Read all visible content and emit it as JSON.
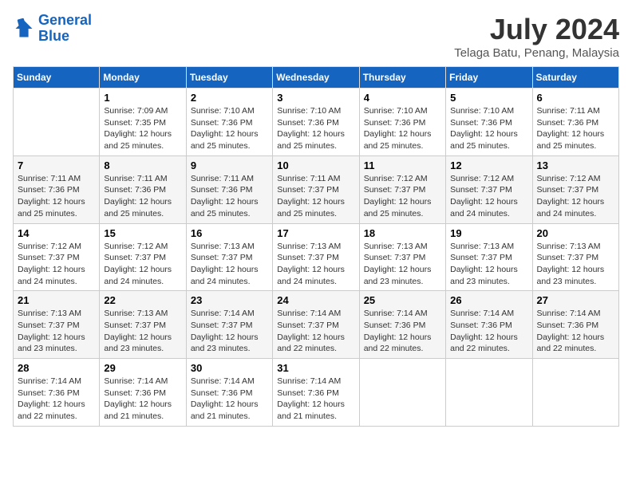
{
  "logo": {
    "line1": "General",
    "line2": "Blue"
  },
  "title": "July 2024",
  "location": "Telaga Batu, Penang, Malaysia",
  "headers": [
    "Sunday",
    "Monday",
    "Tuesday",
    "Wednesday",
    "Thursday",
    "Friday",
    "Saturday"
  ],
  "weeks": [
    [
      null,
      {
        "day": "1",
        "sunrise": "7:09 AM",
        "sunset": "7:35 PM",
        "daylight": "12 hours and 25 minutes."
      },
      {
        "day": "2",
        "sunrise": "7:10 AM",
        "sunset": "7:36 PM",
        "daylight": "12 hours and 25 minutes."
      },
      {
        "day": "3",
        "sunrise": "7:10 AM",
        "sunset": "7:36 PM",
        "daylight": "12 hours and 25 minutes."
      },
      {
        "day": "4",
        "sunrise": "7:10 AM",
        "sunset": "7:36 PM",
        "daylight": "12 hours and 25 minutes."
      },
      {
        "day": "5",
        "sunrise": "7:10 AM",
        "sunset": "7:36 PM",
        "daylight": "12 hours and 25 minutes."
      },
      {
        "day": "6",
        "sunrise": "7:11 AM",
        "sunset": "7:36 PM",
        "daylight": "12 hours and 25 minutes."
      }
    ],
    [
      {
        "day": "7",
        "sunrise": "7:11 AM",
        "sunset": "7:36 PM",
        "daylight": "12 hours and 25 minutes."
      },
      {
        "day": "8",
        "sunrise": "7:11 AM",
        "sunset": "7:36 PM",
        "daylight": "12 hours and 25 minutes."
      },
      {
        "day": "9",
        "sunrise": "7:11 AM",
        "sunset": "7:36 PM",
        "daylight": "12 hours and 25 minutes."
      },
      {
        "day": "10",
        "sunrise": "7:11 AM",
        "sunset": "7:37 PM",
        "daylight": "12 hours and 25 minutes."
      },
      {
        "day": "11",
        "sunrise": "7:12 AM",
        "sunset": "7:37 PM",
        "daylight": "12 hours and 25 minutes."
      },
      {
        "day": "12",
        "sunrise": "7:12 AM",
        "sunset": "7:37 PM",
        "daylight": "12 hours and 24 minutes."
      },
      {
        "day": "13",
        "sunrise": "7:12 AM",
        "sunset": "7:37 PM",
        "daylight": "12 hours and 24 minutes."
      }
    ],
    [
      {
        "day": "14",
        "sunrise": "7:12 AM",
        "sunset": "7:37 PM",
        "daylight": "12 hours and 24 minutes."
      },
      {
        "day": "15",
        "sunrise": "7:12 AM",
        "sunset": "7:37 PM",
        "daylight": "12 hours and 24 minutes."
      },
      {
        "day": "16",
        "sunrise": "7:13 AM",
        "sunset": "7:37 PM",
        "daylight": "12 hours and 24 minutes."
      },
      {
        "day": "17",
        "sunrise": "7:13 AM",
        "sunset": "7:37 PM",
        "daylight": "12 hours and 24 minutes."
      },
      {
        "day": "18",
        "sunrise": "7:13 AM",
        "sunset": "7:37 PM",
        "daylight": "12 hours and 23 minutes."
      },
      {
        "day": "19",
        "sunrise": "7:13 AM",
        "sunset": "7:37 PM",
        "daylight": "12 hours and 23 minutes."
      },
      {
        "day": "20",
        "sunrise": "7:13 AM",
        "sunset": "7:37 PM",
        "daylight": "12 hours and 23 minutes."
      }
    ],
    [
      {
        "day": "21",
        "sunrise": "7:13 AM",
        "sunset": "7:37 PM",
        "daylight": "12 hours and 23 minutes."
      },
      {
        "day": "22",
        "sunrise": "7:13 AM",
        "sunset": "7:37 PM",
        "daylight": "12 hours and 23 minutes."
      },
      {
        "day": "23",
        "sunrise": "7:14 AM",
        "sunset": "7:37 PM",
        "daylight": "12 hours and 23 minutes."
      },
      {
        "day": "24",
        "sunrise": "7:14 AM",
        "sunset": "7:37 PM",
        "daylight": "12 hours and 22 minutes."
      },
      {
        "day": "25",
        "sunrise": "7:14 AM",
        "sunset": "7:36 PM",
        "daylight": "12 hours and 22 minutes."
      },
      {
        "day": "26",
        "sunrise": "7:14 AM",
        "sunset": "7:36 PM",
        "daylight": "12 hours and 22 minutes."
      },
      {
        "day": "27",
        "sunrise": "7:14 AM",
        "sunset": "7:36 PM",
        "daylight": "12 hours and 22 minutes."
      }
    ],
    [
      {
        "day": "28",
        "sunrise": "7:14 AM",
        "sunset": "7:36 PM",
        "daylight": "12 hours and 22 minutes."
      },
      {
        "day": "29",
        "sunrise": "7:14 AM",
        "sunset": "7:36 PM",
        "daylight": "12 hours and 21 minutes."
      },
      {
        "day": "30",
        "sunrise": "7:14 AM",
        "sunset": "7:36 PM",
        "daylight": "12 hours and 21 minutes."
      },
      {
        "day": "31",
        "sunrise": "7:14 AM",
        "sunset": "7:36 PM",
        "daylight": "12 hours and 21 minutes."
      },
      null,
      null,
      null
    ]
  ]
}
